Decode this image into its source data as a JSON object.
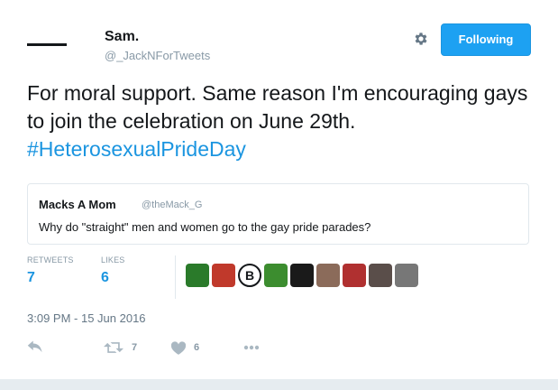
{
  "tweet": {
    "author_name": "Sam.",
    "author_handle": "@_JackNForTweets",
    "follow_button": "Following",
    "text_plain": "For moral support. Same reason I'm encouraging gays to join the celebration on June 29th. ",
    "hashtag": "#HeterosexualPrideDay",
    "timestamp": "3:09 PM - 15 Jun 2016"
  },
  "quoted": {
    "name": "Macks A Mom",
    "handle": "@theMack_G",
    "text": "Why do \"straight\" men and women go to the gay pride parades?"
  },
  "stats": {
    "retweets_label": "RETWEETS",
    "retweets_value": "7",
    "likes_label": "LIKES",
    "likes_value": "6"
  },
  "favoriters": [
    "#2a7a2a",
    "#c0392b",
    "B",
    "#3c8d2f",
    "#1a1a1a",
    "#8b6b5a",
    "#b03030",
    "#5a4e4a",
    "#777777"
  ],
  "actions": {
    "retweet_count": "7",
    "like_count": "6"
  },
  "colors": {
    "accent": "#1da1f2",
    "link": "#1b95e0",
    "muted": "#8899a6"
  }
}
